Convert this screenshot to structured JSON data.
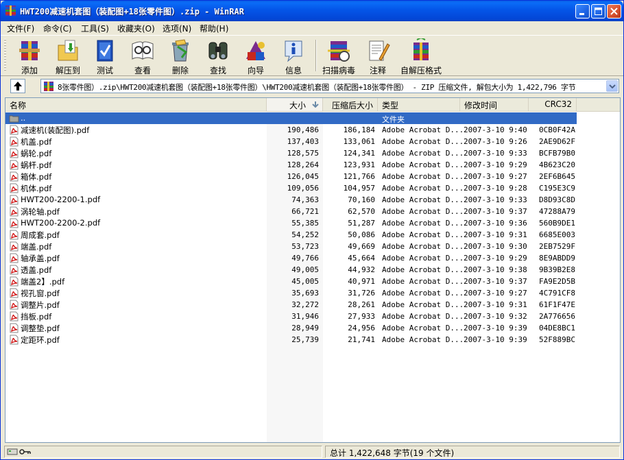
{
  "window": {
    "title": "HWT200减速机套图（装配图+18张零件图）.zip - WinRAR",
    "minimize": "minimize",
    "maximize": "maximize",
    "close": "close"
  },
  "menu": [
    "文件(F)",
    "命令(C)",
    "工具(S)",
    "收藏夹(O)",
    "选项(N)",
    "帮助(H)"
  ],
  "toolbar": [
    {
      "label": "添加",
      "icon": "add-archive-icon"
    },
    {
      "label": "解压到",
      "icon": "extract-to-icon"
    },
    {
      "label": "测试",
      "icon": "test-icon"
    },
    {
      "label": "查看",
      "icon": "view-icon"
    },
    {
      "label": "删除",
      "icon": "delete-icon"
    },
    {
      "label": "查找",
      "icon": "find-icon"
    },
    {
      "label": "向导",
      "icon": "wizard-icon"
    },
    {
      "label": "信息",
      "icon": "info-icon"
    },
    {
      "label": "扫描病毒",
      "icon": "scan-virus-icon"
    },
    {
      "label": "注释",
      "icon": "comment-icon"
    },
    {
      "label": "自解压格式",
      "icon": "sfx-icon"
    }
  ],
  "address": {
    "path": "8张零件图）.zip\\HWT200减速机套图（装配图+18张零件图）\\HWT200减速机套图（装配图+18张零件图） - ZIP 压缩文件, 解包大小为 1,422,796 字节"
  },
  "columns": {
    "name": "名称",
    "size": "大小",
    "packed": "压缩后大小",
    "type": "类型",
    "modified": "修改时间",
    "crc": "CRC32"
  },
  "parent_row": {
    "name": "..",
    "type": "文件夹"
  },
  "files": [
    {
      "name": "减速机(装配图).pdf",
      "size": "190,486",
      "packed": "186,184",
      "type": "Adobe Acrobat D...",
      "modified": "2007-3-10 9:40",
      "crc": "0CB0F42A"
    },
    {
      "name": "机盖.pdf",
      "size": "137,403",
      "packed": "133,061",
      "type": "Adobe Acrobat D...",
      "modified": "2007-3-10 9:26",
      "crc": "2AE9D62F"
    },
    {
      "name": "蜗轮.pdf",
      "size": "128,575",
      "packed": "124,341",
      "type": "Adobe Acrobat D...",
      "modified": "2007-3-10 9:33",
      "crc": "BCFB79B0"
    },
    {
      "name": "蜗杆.pdf",
      "size": "128,264",
      "packed": "123,931",
      "type": "Adobe Acrobat D...",
      "modified": "2007-3-10 9:29",
      "crc": "4B623C20"
    },
    {
      "name": "箱体.pdf",
      "size": "126,045",
      "packed": "121,766",
      "type": "Adobe Acrobat D...",
      "modified": "2007-3-10 9:27",
      "crc": "2EF6B645"
    },
    {
      "name": "机体.pdf",
      "size": "109,056",
      "packed": "104,957",
      "type": "Adobe Acrobat D...",
      "modified": "2007-3-10 9:28",
      "crc": "C195E3C9"
    },
    {
      "name": "HWT200-2200-1.pdf",
      "size": "74,363",
      "packed": "70,160",
      "type": "Adobe Acrobat D...",
      "modified": "2007-3-10 9:33",
      "crc": "D8D93C8D"
    },
    {
      "name": "涡轮轴.pdf",
      "size": "66,721",
      "packed": "62,570",
      "type": "Adobe Acrobat D...",
      "modified": "2007-3-10 9:37",
      "crc": "47288A79"
    },
    {
      "name": "HWT200-2200-2.pdf",
      "size": "55,385",
      "packed": "51,287",
      "type": "Adobe Acrobat D...",
      "modified": "2007-3-10 9:36",
      "crc": "560B9DE1"
    },
    {
      "name": "周成套.pdf",
      "size": "54,252",
      "packed": "50,086",
      "type": "Adobe Acrobat D...",
      "modified": "2007-3-10 9:31",
      "crc": "6685E003"
    },
    {
      "name": "端盖.pdf",
      "size": "53,723",
      "packed": "49,669",
      "type": "Adobe Acrobat D...",
      "modified": "2007-3-10 9:30",
      "crc": "2EB7529F"
    },
    {
      "name": "轴承盖.pdf",
      "size": "49,766",
      "packed": "45,664",
      "type": "Adobe Acrobat D...",
      "modified": "2007-3-10 9:29",
      "crc": "8E9ABDD9"
    },
    {
      "name": "透盖.pdf",
      "size": "49,005",
      "packed": "44,932",
      "type": "Adobe Acrobat D...",
      "modified": "2007-3-10 9:38",
      "crc": "9B39B2E8"
    },
    {
      "name": "端盖2】.pdf",
      "size": "45,005",
      "packed": "40,971",
      "type": "Adobe Acrobat D...",
      "modified": "2007-3-10 9:37",
      "crc": "FA9E2D5B"
    },
    {
      "name": "视孔窗.pdf",
      "size": "35,693",
      "packed": "31,726",
      "type": "Adobe Acrobat D...",
      "modified": "2007-3-10 9:27",
      "crc": "4C791CF8"
    },
    {
      "name": "调整片.pdf",
      "size": "32,272",
      "packed": "28,261",
      "type": "Adobe Acrobat D...",
      "modified": "2007-3-10 9:31",
      "crc": "61F1F47E"
    },
    {
      "name": "挡板.pdf",
      "size": "31,946",
      "packed": "27,933",
      "type": "Adobe Acrobat D...",
      "modified": "2007-3-10 9:32",
      "crc": "2A776656"
    },
    {
      "name": "调整垫.pdf",
      "size": "28,949",
      "packed": "24,956",
      "type": "Adobe Acrobat D...",
      "modified": "2007-3-10 9:39",
      "crc": "04DE8BC1"
    },
    {
      "name": "定距环.pdf",
      "size": "25,739",
      "packed": "21,741",
      "type": "Adobe Acrobat D...",
      "modified": "2007-3-10 9:39",
      "crc": "52F889BC"
    }
  ],
  "status": {
    "total": "总计 1,422,648 字节(19 个文件)"
  },
  "colors": {
    "selection": "#316ac5",
    "titlebar": "#0455e8",
    "pdf_red": "#d01010"
  }
}
